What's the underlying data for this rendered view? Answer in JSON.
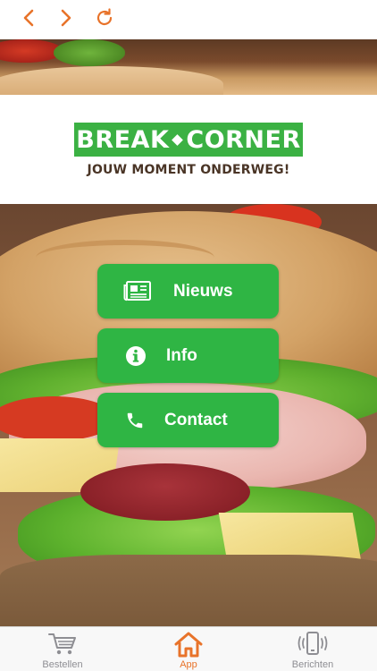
{
  "nav": {
    "back_icon": "chevron-left-icon",
    "forward_icon": "chevron-right-icon",
    "reload_icon": "reload-icon"
  },
  "logo": {
    "word1": "BREAK",
    "word2": "CORNER",
    "tagline": "JOUW MOMENT ONDERWEG!"
  },
  "menu": {
    "items": [
      {
        "label": "Nieuws",
        "icon": "newspaper-icon"
      },
      {
        "label": "Info",
        "icon": "info-icon"
      },
      {
        "label": "Contact",
        "icon": "phone-icon"
      }
    ]
  },
  "tabbar": {
    "items": [
      {
        "label": "Bestellen",
        "icon": "cart-icon",
        "active": false
      },
      {
        "label": "App",
        "icon": "home-icon",
        "active": true
      },
      {
        "label": "Berichten",
        "icon": "phone-vibrate-icon",
        "active": false
      }
    ]
  },
  "colors": {
    "accent": "#e8732a",
    "brand_green": "#3bb143",
    "button_green": "#2fb544",
    "tab_inactive": "#8e8e93",
    "tagline": "#4a3526"
  }
}
